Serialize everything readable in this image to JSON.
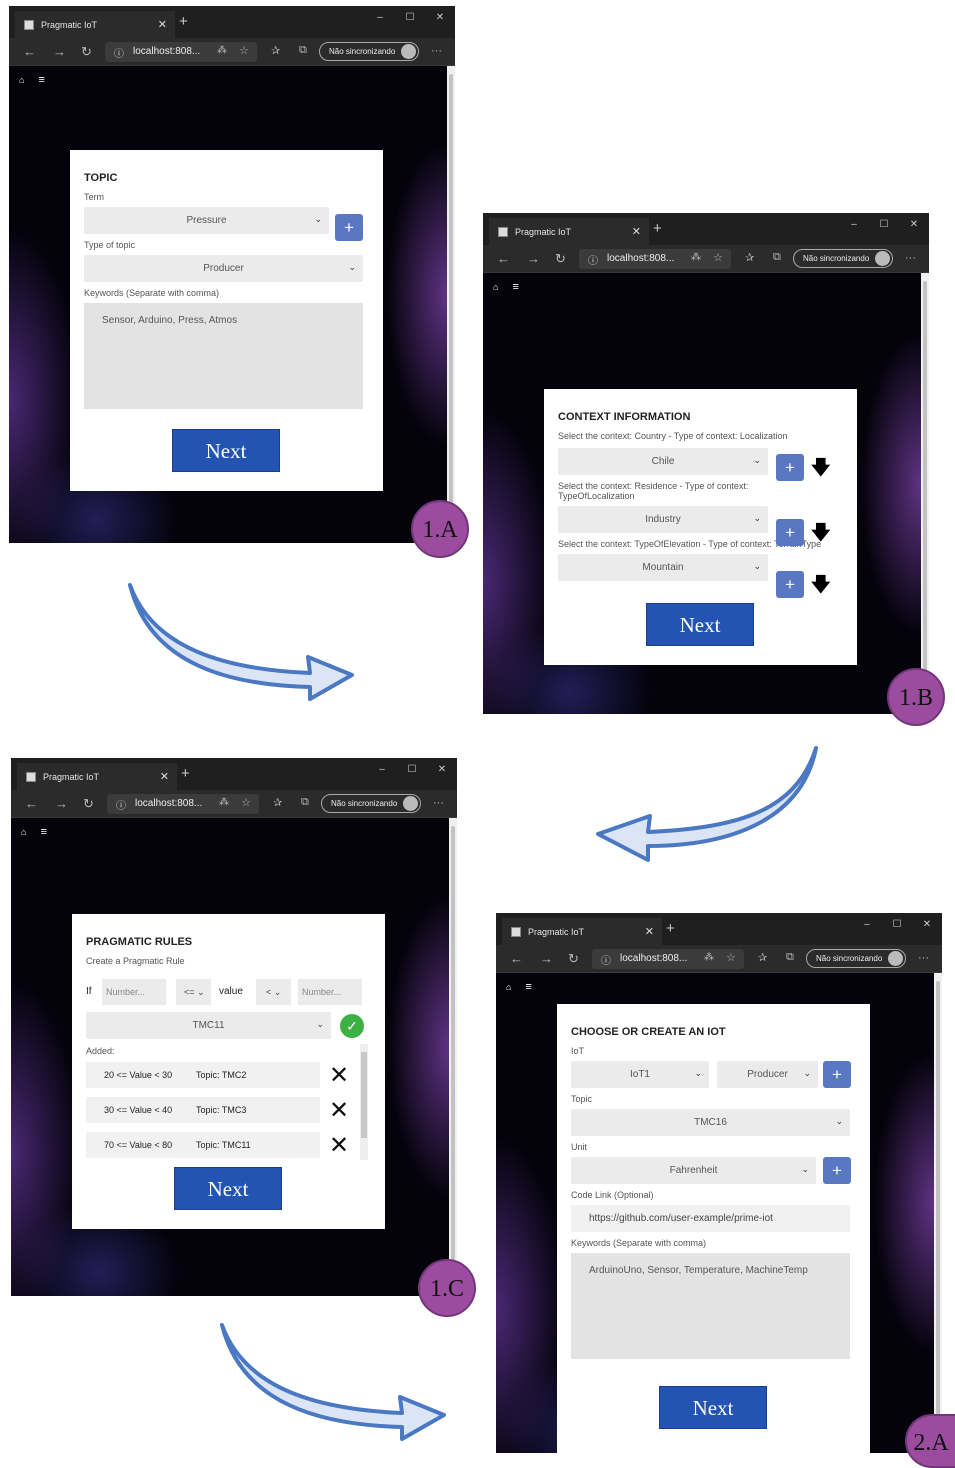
{
  "browser": {
    "tab_title": "Pragmatic IoT",
    "new_tab": "+",
    "address": "localhost:808...",
    "sync_label": "Não sincronizando",
    "win_min": "–",
    "win_max": "☐",
    "win_close": "✕",
    "back": "←",
    "forward": "→",
    "refresh": "↻",
    "more": "···"
  },
  "app": {
    "home_icon": "home-icon",
    "menu_icon": "menu-icon"
  },
  "screen_a": {
    "title": "TOPIC",
    "term_label": "Term",
    "term_value": "Pressure",
    "type_label": "Type of topic",
    "type_value": "Producer",
    "keywords_label": "Keywords (Separate with comma)",
    "keywords_value": "Sensor, Arduino, Press, Atmos",
    "next_label": "Next",
    "badge": "1.A"
  },
  "screen_b": {
    "title": "CONTEXT INFORMATION",
    "contexts": [
      {
        "label": "Select the context: Country - Type of context: Localization",
        "value": "Chile"
      },
      {
        "label": "Select the context: Residence - Type of context: TypeOfLocalization",
        "value": "Industry"
      },
      {
        "label": "Select the context: TypeOfElevation - Type of context: TerrainType",
        "value": "Mountain"
      }
    ],
    "next_label": "Next",
    "badge": "1.B"
  },
  "screen_c": {
    "title": "PRAGMATIC RULES",
    "subtitle": "Create a Pragmatic Rule",
    "if_label": "If",
    "number_placeholder": "Number...",
    "op1": "<=",
    "value_label": "value",
    "op2": "<",
    "topic_value": "TMC11",
    "added_label": "Added:",
    "rules": [
      {
        "range": "20 <= Value < 30",
        "topic": "Topic: TMC2"
      },
      {
        "range": "30 <= Value < 40",
        "topic": "Topic: TMC3"
      },
      {
        "range": "70 <= Value < 80",
        "topic": "Topic: TMC11"
      }
    ],
    "next_label": "Next",
    "badge": "1.C"
  },
  "screen_d": {
    "title": "CHOOSE OR CREATE AN IOT",
    "iot_label": "IoT",
    "iot_value": "IoT1",
    "role_value": "Producer",
    "topic_label": "Topic",
    "topic_value": "TMC16",
    "unit_label": "Unit",
    "unit_value": "Fahrenheit",
    "code_label": "Code Link (Optional)",
    "code_value": "https://github.com/user-example/prime-iot",
    "keywords_label": "Keywords (Separate with comma)",
    "keywords_value": "ArduinoUno, Sensor, Temperature, MachineTemp",
    "next_label": "Next",
    "badge": "2.A"
  },
  "colors": {
    "accent": "#2354b4",
    "plus": "#5a77c4",
    "badge": "#9c4c9f",
    "check": "#3cb043"
  }
}
